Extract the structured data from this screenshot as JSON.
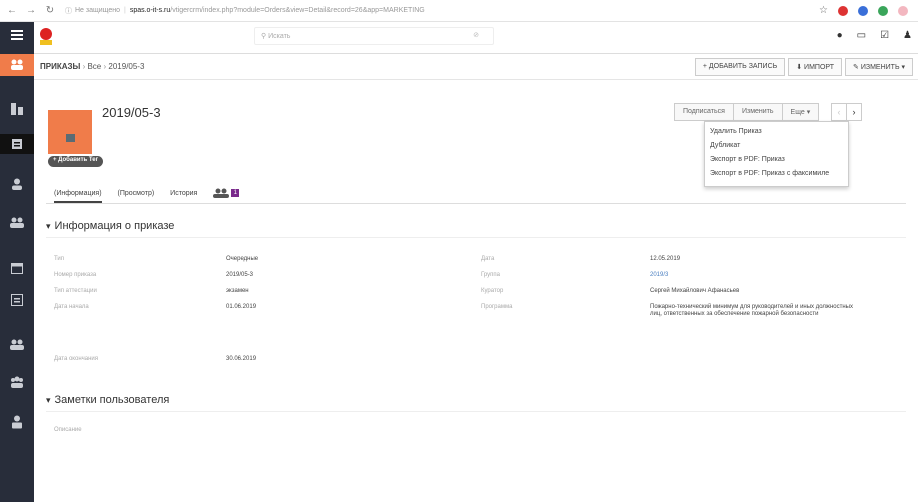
{
  "browser": {
    "insecure_label": "Не защищено",
    "host": "spas.o-it-s.ru",
    "path": "/vtigercrm/index.php?module=Orders&view=Detail&record=26&app=MARKETING"
  },
  "search": {
    "placeholder": "Искать"
  },
  "breadcrumb": {
    "module": "ПРИКАЗЫ",
    "middle": "Все",
    "record": "2019/05-3"
  },
  "actions": {
    "add": "+ ДОБАВИТЬ ЗАПИСЬ",
    "import": "⬇ ИМПОРТ",
    "edit": "✎ ИЗМЕНИТЬ ▾"
  },
  "record": {
    "title": "2019/05-3",
    "add_tag": "+ Добавить Тег"
  },
  "header_buttons": {
    "subscribe": "Подписаться",
    "edit": "Изменить",
    "more": "Еще ▾",
    "prev": "‹",
    "next": "›"
  },
  "more_menu": [
    "Удалить Приказ",
    "Дубликат",
    "Экспорт в PDF: Приказ",
    "Экспорт в PDF: Приказ с факсимиле"
  ],
  "tabs": [
    {
      "label": "(Информация)"
    },
    {
      "label": "(Просмотр)"
    },
    {
      "label": "История"
    }
  ],
  "tab_badge": "1",
  "info_section": {
    "title": "Информация о приказе",
    "left": [
      {
        "label": "Тип",
        "value": "Очередные"
      },
      {
        "label": "Номер приказа",
        "value": "2019/05-3"
      },
      {
        "label": "Тип аттестации",
        "value": "экзамен"
      },
      {
        "label": "Дата начала",
        "value": "01.06.2019"
      },
      {
        "label": "Дата окончания",
        "value": "30.06.2019"
      }
    ],
    "right": [
      {
        "label": "Дата",
        "value": "12.05.2019"
      },
      {
        "label": "Группа",
        "value": "2019/3"
      },
      {
        "label": "Куратор",
        "value": "Сергей Михайлович Афанасьев"
      },
      {
        "label": "Программа",
        "value": "Пожарно-технический минимум для руководителей и иных должностных лиц, ответственных за обеспечение пожарной безопасности"
      }
    ]
  },
  "notes_section": {
    "title": "Заметки пользователя",
    "field": "Описание"
  },
  "colors": {
    "sidebar": "#282d3a",
    "accent": "#f07c4a",
    "badge": "#7a2a8c"
  }
}
